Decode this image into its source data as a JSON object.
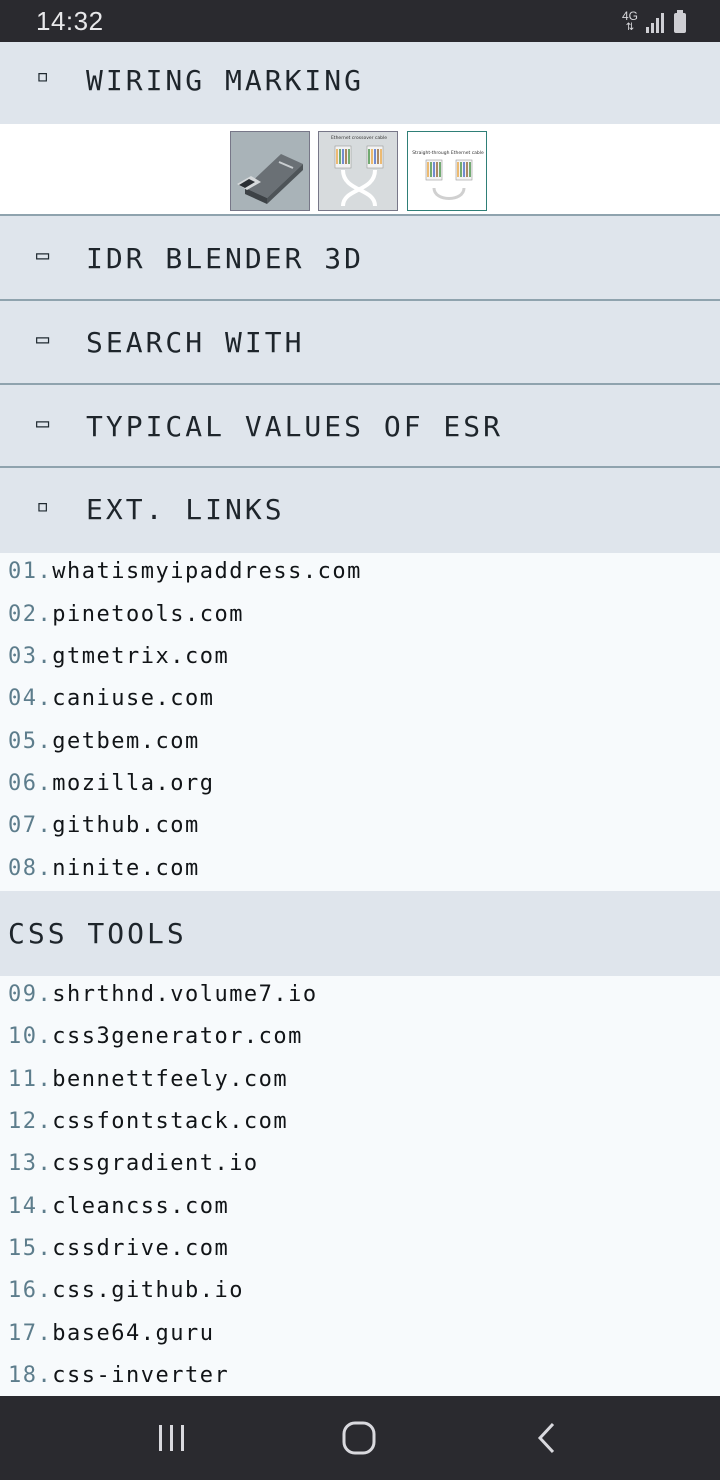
{
  "status_bar": {
    "time": "14:32",
    "network": "4G",
    "icons": [
      "network-4g-icon",
      "signal-icon",
      "battery-icon"
    ]
  },
  "sections": [
    {
      "marker": "▫",
      "title": "WIRING MARKING"
    },
    {
      "marker": "▭",
      "title": "IDR BLENDER 3D"
    },
    {
      "marker": "▭",
      "title": "SEARCH WITH"
    },
    {
      "marker": "▭",
      "title": "TYPICAL VALUES OF ESR"
    },
    {
      "marker": "▫",
      "title": "EXT. LINKS"
    }
  ],
  "thumbnails": [
    {
      "name": "usb-flash-drive-image",
      "text": ""
    },
    {
      "name": "ethernet-crossover-cable-image",
      "text": "Ethernet crossover cable"
    },
    {
      "name": "straight-through-ethernet-cable-image",
      "text": "Straight-through Ethernet cable"
    }
  ],
  "ext_links": [
    {
      "num": "01.",
      "url": "whatismyipaddress.com"
    },
    {
      "num": "02.",
      "url": "pinetools.com"
    },
    {
      "num": "03.",
      "url": "gtmetrix.com"
    },
    {
      "num": "04.",
      "url": "caniuse.com"
    },
    {
      "num": "05.",
      "url": "getbem.com"
    },
    {
      "num": "06.",
      "url": "mozilla.org"
    },
    {
      "num": "07.",
      "url": "github.com"
    },
    {
      "num": "08.",
      "url": "ninite.com"
    }
  ],
  "css_tools": {
    "title": "CSS TOOLS",
    "links": [
      {
        "num": "09.",
        "url": "shrthnd.volume7.io"
      },
      {
        "num": "10.",
        "url": "css3generator.com"
      },
      {
        "num": "11.",
        "url": "bennettfeely.com"
      },
      {
        "num": "12.",
        "url": "cssfontstack.com"
      },
      {
        "num": "13.",
        "url": "cssgradient.io"
      },
      {
        "num": "14.",
        "url": "cleancss.com"
      },
      {
        "num": "15.",
        "url": "cssdrive.com"
      },
      {
        "num": "16.",
        "url": "css.github.io"
      },
      {
        "num": "17.",
        "url": "base64.guru"
      },
      {
        "num": "18.",
        "url": "css-inverter"
      }
    ]
  },
  "nav_bar": {
    "buttons": [
      "recent-apps-icon",
      "home-icon",
      "back-icon"
    ]
  },
  "colors": {
    "header_bg": "#dfe5ec",
    "divider": "#8fa3ae",
    "number_accent": "#5d7d8c",
    "system_bar": "#2a2a2f"
  }
}
